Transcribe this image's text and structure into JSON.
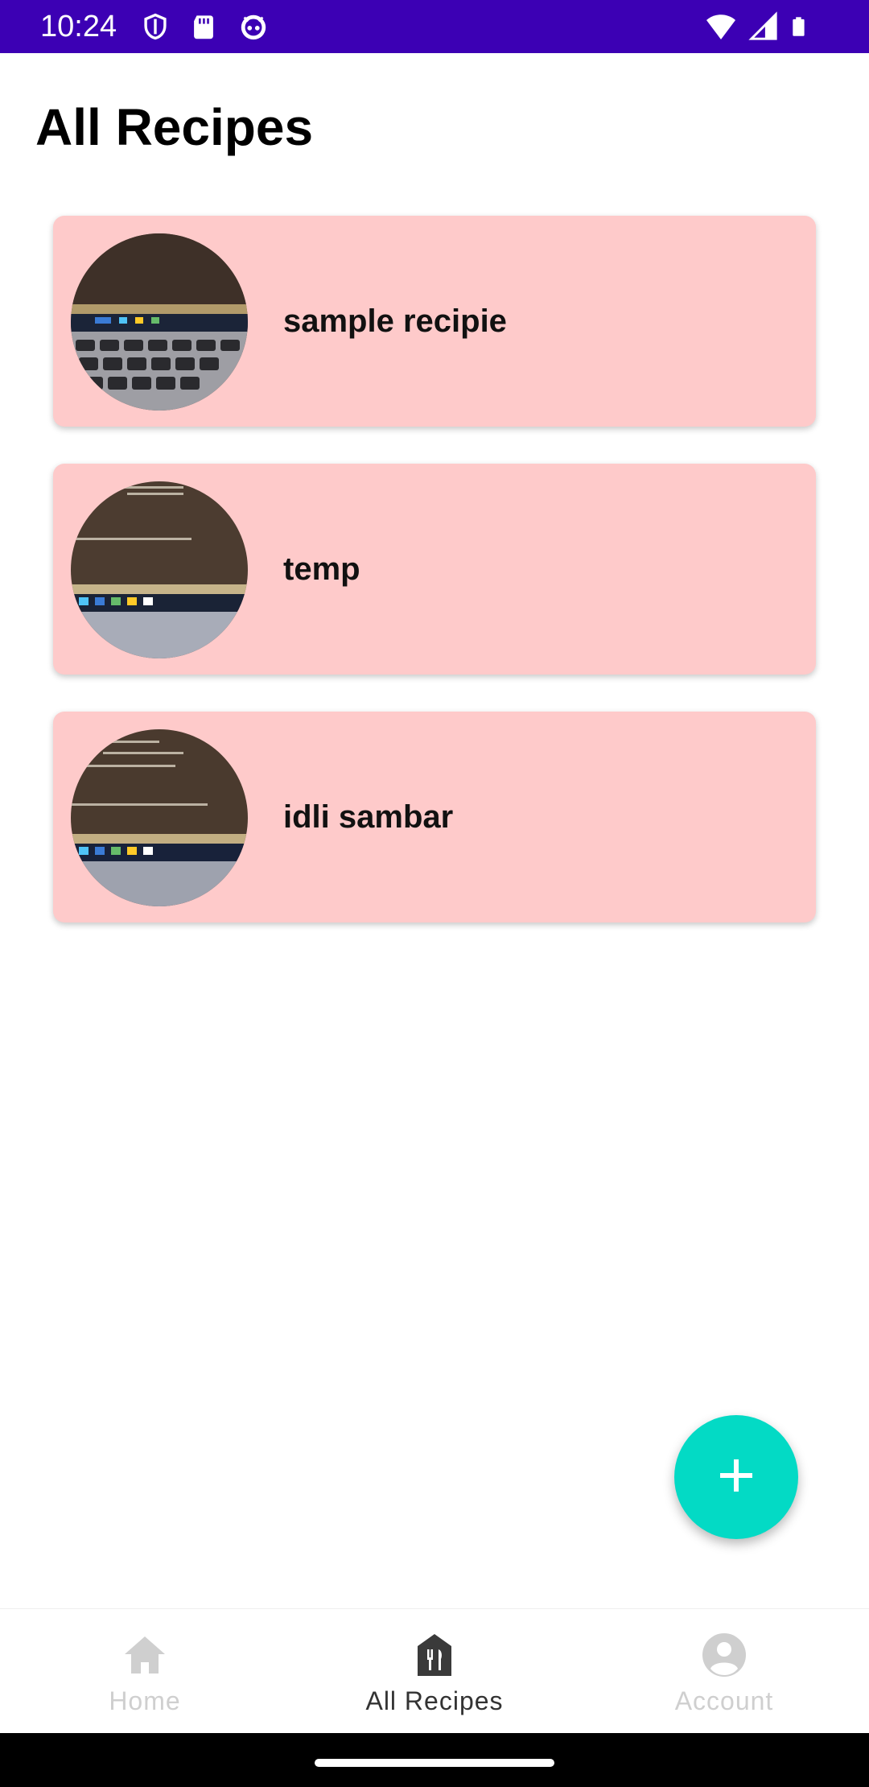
{
  "status_bar": {
    "time": "10:24",
    "left_icons": [
      "shield-icon",
      "sd-card-icon",
      "android-face-icon"
    ],
    "right_icons": [
      "wifi-icon",
      "signal-icon",
      "battery-icon"
    ],
    "background": "#3c00b4"
  },
  "page_title": "All Recipes",
  "recipes": [
    {
      "name": "sample recipie"
    },
    {
      "name": "temp"
    },
    {
      "name": "idli sambar"
    }
  ],
  "card_color": "#fecaca",
  "fab": {
    "icon": "plus-icon",
    "color": "#03dac5"
  },
  "bottom_nav": {
    "items": [
      {
        "label": "Home",
        "icon": "home-icon",
        "active": false
      },
      {
        "label": "All Recipes",
        "icon": "recipe-book-icon",
        "active": true
      },
      {
        "label": "Account",
        "icon": "account-circle-icon",
        "active": false
      }
    ]
  }
}
